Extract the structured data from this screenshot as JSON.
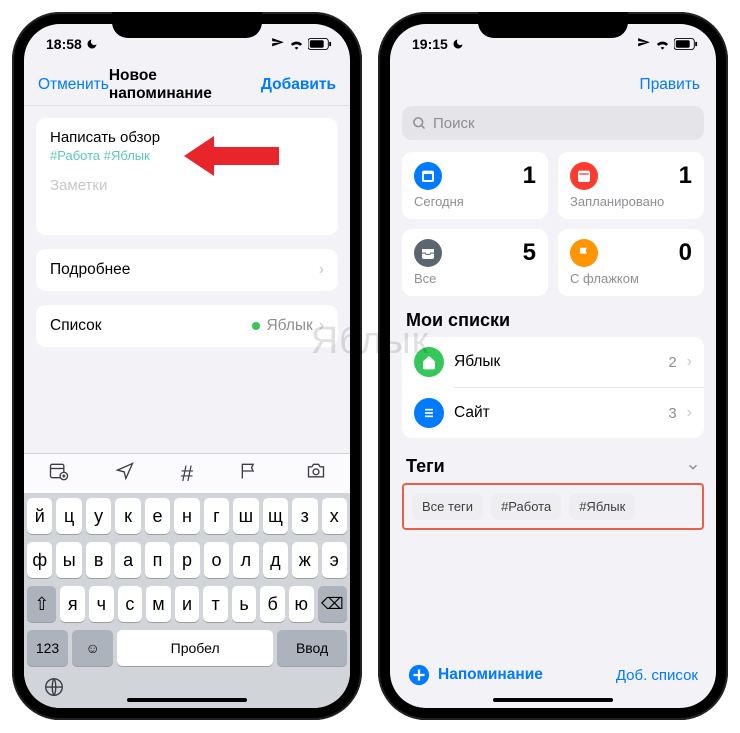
{
  "watermark": "Яблык",
  "left": {
    "status": {
      "time": "18:58"
    },
    "nav": {
      "cancel": "Отменить",
      "title": "Новое напоминание",
      "add": "Добавить"
    },
    "reminder": {
      "title": "Написать обзор",
      "tags": "#Работа #Яблык",
      "notes_placeholder": "Заметки"
    },
    "details_label": "Подробнее",
    "list_label": "Список",
    "list_value": "Яблык",
    "list_dot_color": "#34c759",
    "keyboard": {
      "row1": [
        "й",
        "ц",
        "у",
        "к",
        "е",
        "н",
        "г",
        "ш",
        "щ",
        "з",
        "х"
      ],
      "row2": [
        "ф",
        "ы",
        "в",
        "а",
        "п",
        "р",
        "о",
        "л",
        "д",
        "ж",
        "э"
      ],
      "row3": [
        "я",
        "ч",
        "с",
        "м",
        "и",
        "т",
        "ь",
        "б",
        "ю"
      ],
      "shift": "⇧",
      "bksp": "⌫",
      "num": "123",
      "emoji": "☺",
      "space": "Пробел",
      "enter": "Ввод"
    }
  },
  "right": {
    "status": {
      "time": "19:15"
    },
    "edit": "Править",
    "search_placeholder": "Поиск",
    "cards": {
      "today": {
        "label": "Сегодня",
        "count": "1",
        "color": "#007aff"
      },
      "planned": {
        "label": "Запланировано",
        "count": "1",
        "color": "#ff3b30"
      },
      "all": {
        "label": "Все",
        "count": "5",
        "color": "#5b6670"
      },
      "flagged": {
        "label": "С флажком",
        "count": "0",
        "color": "#ff9500"
      }
    },
    "mylists_header": "Мои списки",
    "lists": [
      {
        "name": "Яблык",
        "count": "2",
        "color": "#34c759",
        "icon": "home"
      },
      {
        "name": "Сайт",
        "count": "3",
        "color": "#007aff",
        "icon": "list"
      }
    ],
    "tags_header": "Теги",
    "tags": [
      "Все теги",
      "#Работа",
      "#Яблык"
    ],
    "add_reminder": "Напоминание",
    "add_list": "Доб. список"
  }
}
